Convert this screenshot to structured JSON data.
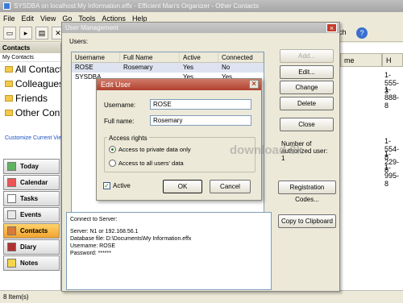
{
  "window": {
    "title": "SYSDBA on localhost:My Information.effx - Efficient Man's Organizer - Other Contacts"
  },
  "menu": [
    "File",
    "Edit",
    "View",
    "Go",
    "Tools",
    "Actions",
    "Help"
  ],
  "toolbar": {
    "fetch_label": "ch",
    "help_label": "?"
  },
  "sidebar": {
    "header": "Contacts",
    "sub": "My Contacts",
    "folders": [
      "All Contacts",
      "Colleagues",
      "Friends",
      "Other Contacts"
    ],
    "customize": "Customize Current View...",
    "nav": [
      "Today",
      "Calendar",
      "Tasks",
      "Events",
      "Contacts",
      "Diary",
      "Notes"
    ]
  },
  "list": {
    "columns": [
      "me",
      "H"
    ],
    "phones": [
      "1-555-3",
      "1-888-8",
      "1-554-8",
      "1-229-8",
      "1-995-8"
    ]
  },
  "status": "8 Item(s)",
  "user_mgmt": {
    "title": "User Management",
    "users_label": "Users:",
    "columns": [
      "Username",
      "Full Name",
      "Active",
      "Connected"
    ],
    "rows": [
      {
        "username": "ROSE",
        "full_name": "Rosemary",
        "active": "Yes",
        "connected": "No"
      },
      {
        "username": "SYSDBA",
        "full_name": "",
        "active": "Yes",
        "connected": "Yes"
      }
    ],
    "buttons": {
      "add": "Add...",
      "edit": "Edit...",
      "change_password": "Change Password...",
      "delete": "Delete",
      "close": "Close",
      "registration": "Registration Codes...",
      "copy": "Copy to Clipboard"
    },
    "authorized_label": "Number of authorized user:",
    "authorized_count": "1",
    "connection": [
      "Connect to Server:",
      "Server: N1 or 192.168.56.1",
      "Database file: D:\\Documents\\My Information.effx",
      "Username: ROSE",
      "Password: ******"
    ]
  },
  "edit_user": {
    "title": "Edit User",
    "username_label": "Username:",
    "username_value": "ROSE",
    "fullname_label": "Full name:",
    "fullname_value": "Rosemary",
    "access_label": "Access rights",
    "radio_private": "Access to private data only",
    "radio_all": "Access to all users' data",
    "active_label": "Active",
    "ok": "OK",
    "cancel": "Cancel"
  },
  "watermark": "download 3k"
}
